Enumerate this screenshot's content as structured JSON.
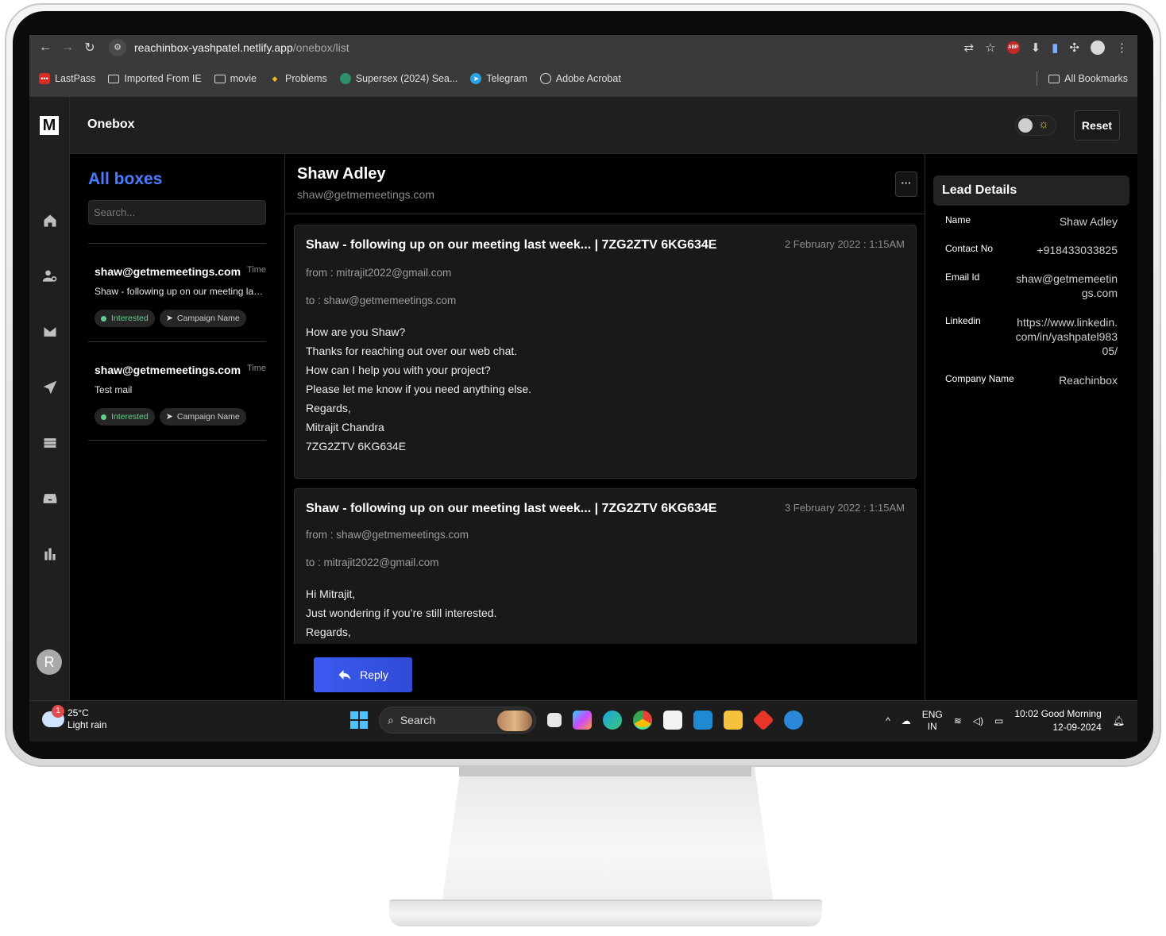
{
  "browser": {
    "url_host": "reachinbox-yashpatel.netlify.app",
    "url_path": "/onebox/list",
    "bookmarks": [
      {
        "label": "LastPass",
        "icon": "lastpass-icon"
      },
      {
        "label": "Imported From IE",
        "icon": "folder-icon"
      },
      {
        "label": "movie",
        "icon": "folder-icon"
      },
      {
        "label": "Problems",
        "icon": "problems-icon"
      },
      {
        "label": "Supersex (2024) Sea...",
        "icon": "site-icon"
      },
      {
        "label": "Telegram",
        "icon": "telegram-icon"
      },
      {
        "label": "Adobe Acrobat",
        "icon": "acrobat-icon"
      }
    ],
    "all_bookmarks": "All Bookmarks",
    "abp_label": "ABP"
  },
  "app": {
    "logo": "M",
    "title": "Onebox",
    "reset_label": "Reset",
    "avatar_initial": "R",
    "theme_icon": "sun-icon"
  },
  "list": {
    "title": "All boxes",
    "search_placeholder": "Search...",
    "items": [
      {
        "from": "shaw@getmemeetings.com",
        "time": "Time",
        "subject": "Shaw - following up on our meeting last ...",
        "status": "Interested",
        "campaign": "Campaign Name"
      },
      {
        "from": "shaw@getmemeetings.com",
        "time": "Time",
        "subject": "Test mail",
        "status": "Interested",
        "campaign": "Campaign Name"
      }
    ]
  },
  "thread": {
    "name": "Shaw Adley",
    "email": "shaw@getmemeetings.com",
    "more_label": "···",
    "messages": [
      {
        "subject": "Shaw - following up on our meeting last week... | 7ZG2ZTV 6KG634E",
        "date": "2 February 2022 : 1:15AM",
        "from": "from : mitrajit2022@gmail.com",
        "to": "to : shaw@getmemeetings.com",
        "body": [
          "How are you Shaw?",
          "Thanks for reaching out over our web chat.",
          "How can I help you with your project?",
          "Please let me know if you need anything else.",
          "Regards,",
          "Mitrajit Chandra",
          "7ZG2ZTV 6KG634E"
        ]
      },
      {
        "subject": "Shaw - following up on our meeting last week... | 7ZG2ZTV 6KG634E",
        "date": "3 February 2022 : 1:15AM",
        "from": "from : shaw@getmemeetings.com",
        "to": "to : mitrajit2022@gmail.com",
        "body": [
          "Hi Mitrajit,",
          "Just wondering if you’re still interested.",
          "Regards,"
        ]
      }
    ],
    "reply_label": "Reply"
  },
  "lead": {
    "title": "Lead Details",
    "fields": [
      {
        "label": "Name",
        "value": "Shaw Adley"
      },
      {
        "label": "Contact No",
        "value": "+918433033825"
      },
      {
        "label": "Email Id",
        "value": "shaw@getmemeetings.com"
      },
      {
        "label": "Linkedin",
        "value": "https://www.linkedin.com/in/yashpatel98305/"
      },
      {
        "label": "Company Name",
        "value": "Reachinbox"
      }
    ]
  },
  "taskbar": {
    "weather_badge": "1",
    "temperature": "25°C",
    "condition": "Light rain",
    "search_label": "Search",
    "lang_top": "ENG",
    "lang_bottom": "IN",
    "time_line": "10:02 Good Morning",
    "date": "12-09-2024"
  }
}
